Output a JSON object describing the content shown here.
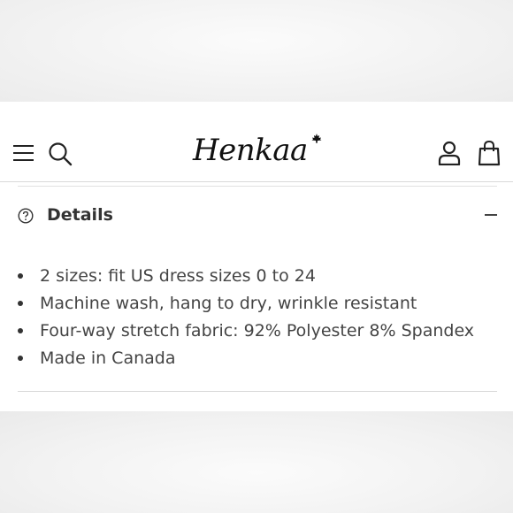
{
  "header": {
    "brand": "Henkaa",
    "menu_icon": "hamburger-menu-icon",
    "search_icon": "search-icon",
    "account_icon": "account-icon",
    "cart_icon": "shopping-bag-icon"
  },
  "details": {
    "title": "Details",
    "help_icon": "question-circle-icon",
    "collapse_icon": "minus-icon",
    "items": [
      "2 sizes: fit US dress sizes 0 to 24",
      "Machine wash, hang to dry, wrinkle resistant",
      "Four-way stretch fabric: 92% Polyester 8% Spandex",
      "Made in Canada"
    ]
  }
}
